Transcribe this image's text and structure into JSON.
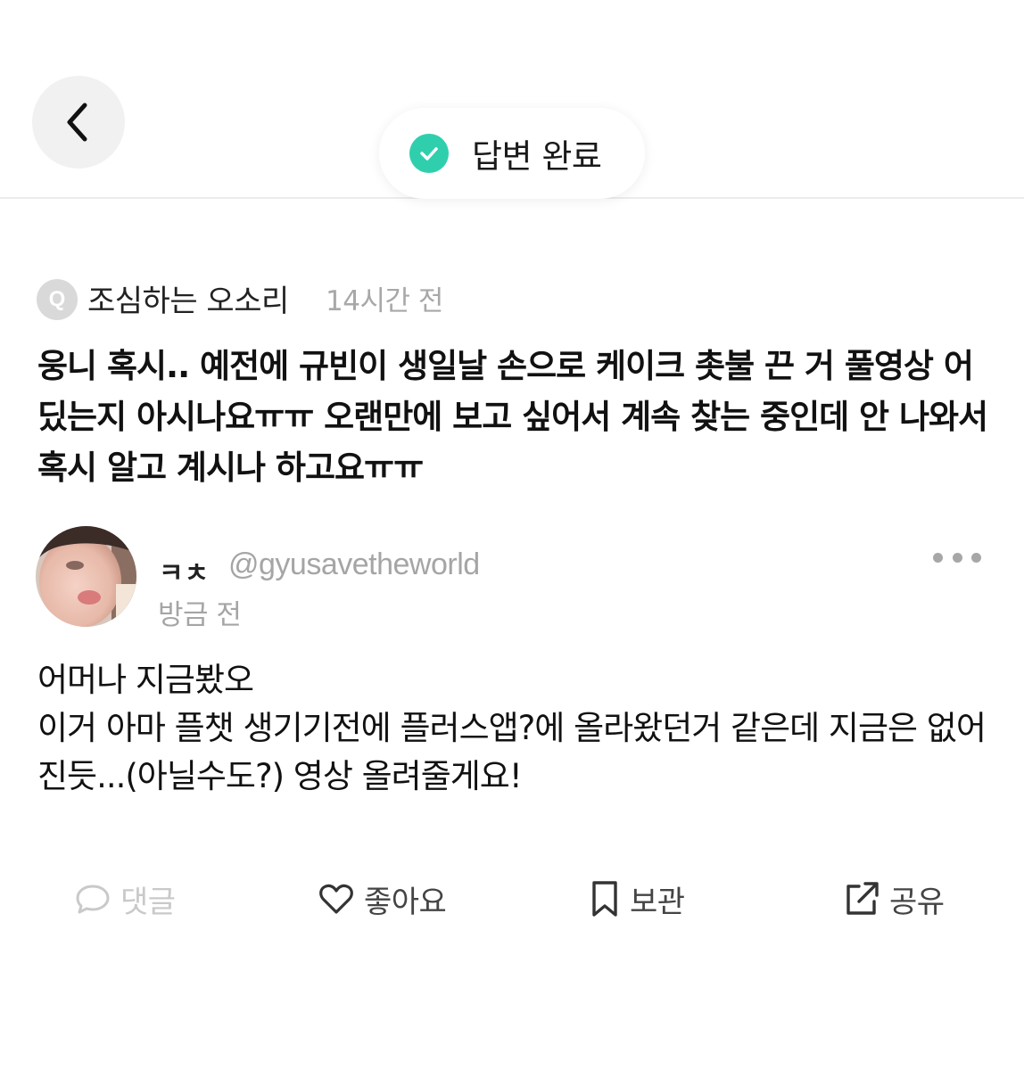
{
  "header": {
    "back_icon": "chevron-left-icon",
    "status_label": "답변 완료",
    "status_icon": "check-circle-icon",
    "status_color": "#2fcfae"
  },
  "question": {
    "badge": "Q",
    "asker": "조심하는 오소리",
    "time": "14시간 전",
    "text": "웅니 혹시.. 예전에 규빈이 생일날 손으로 케이크 촛불 끈 거 풀영상 어딨는지 아시나요ㅠㅠ 오랜만에 보고 싶어서 계속 찾는 중인데 안 나와서 혹시 알고 계시나 하고요ㅠㅠ"
  },
  "answer": {
    "name": "ㅋㅊ",
    "handle": "@gyusavetheworld",
    "time": "방금 전",
    "more_icon": "more-dots-icon",
    "lines": [
      "어머나 지금봤오",
      "이거 아마 플챗 생기기전에 플러스앱?에 올라왔던거 같은데 지금은 없어진듯...(아닐수도?) 영상 올려줄게요!"
    ]
  },
  "actions": {
    "comment": {
      "label": "댓글",
      "icon": "comment-icon",
      "disabled": true
    },
    "like": {
      "label": "좋아요",
      "icon": "heart-icon"
    },
    "save": {
      "label": "보관",
      "icon": "bookmark-icon"
    },
    "share": {
      "label": "공유",
      "icon": "share-icon"
    }
  }
}
